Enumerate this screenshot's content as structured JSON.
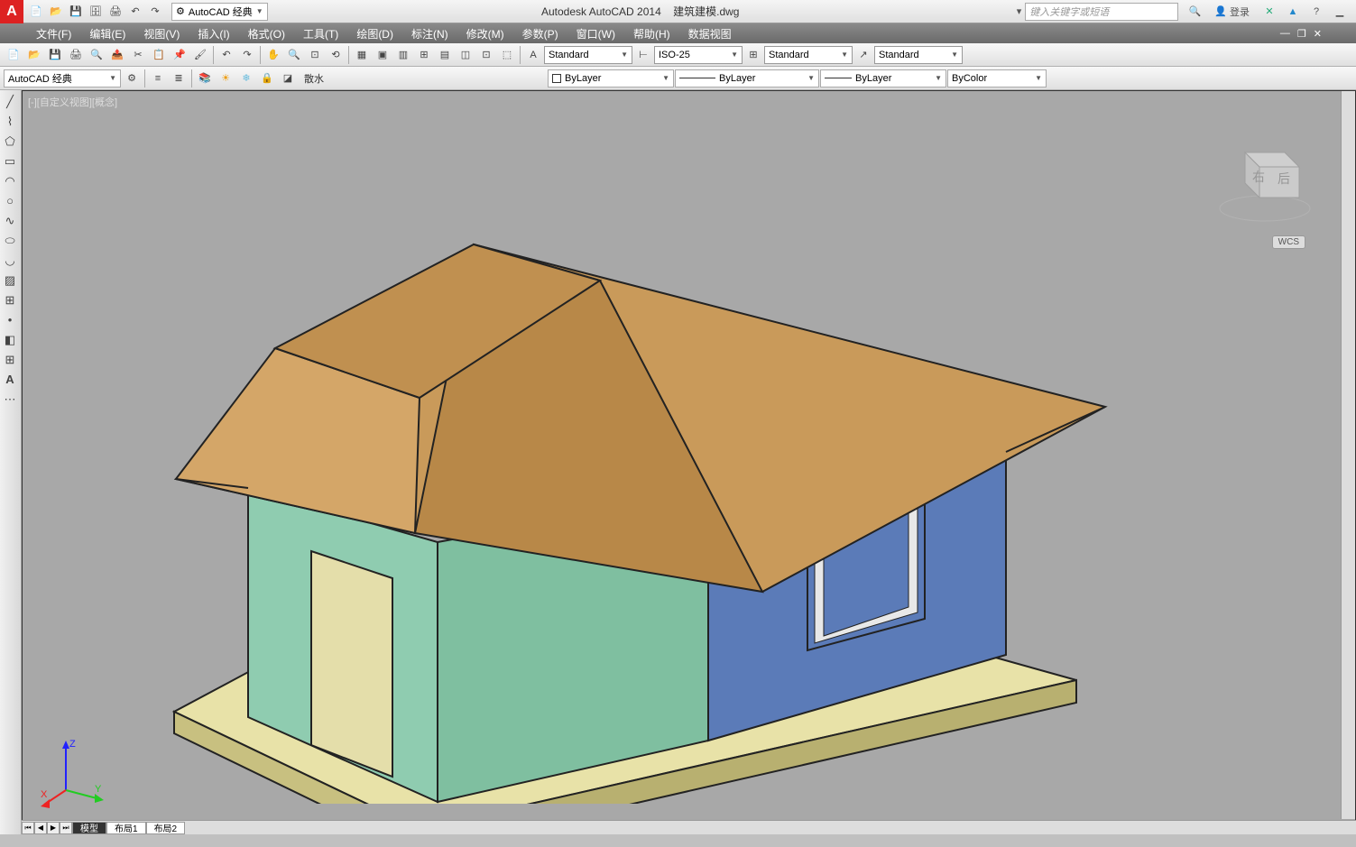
{
  "app": {
    "title_app": "Autodesk AutoCAD 2014",
    "title_file": "建筑建模.dwg",
    "workspace": "AutoCAD 经典",
    "search_placeholder": "键入关键字或短语",
    "login": "登录"
  },
  "menus": [
    "文件(F)",
    "编辑(E)",
    "视图(V)",
    "插入(I)",
    "格式(O)",
    "工具(T)",
    "绘图(D)",
    "标注(N)",
    "修改(M)",
    "参数(P)",
    "窗口(W)",
    "帮助(H)",
    "数据视图"
  ],
  "toolbar2": {
    "workspace": "AutoCAD 经典",
    "explode_label": "散水"
  },
  "styles": {
    "text": "Standard",
    "dim": "ISO-25",
    "table": "Standard",
    "mleader": "Standard"
  },
  "layers": {
    "current": "ByLayer",
    "linetype": "ByLayer",
    "lineweight": "ByLayer",
    "plotcolor": "ByColor"
  },
  "viewport": {
    "label": "[-][自定义视图][概念]",
    "wcs": "WCS"
  },
  "ucs": {
    "x": "X",
    "y": "Y",
    "z": "Z"
  },
  "tabs": {
    "model": "模型",
    "layout1": "布局1",
    "layout2": "布局2"
  },
  "viewcube": {
    "right": "右",
    "back": "后"
  }
}
